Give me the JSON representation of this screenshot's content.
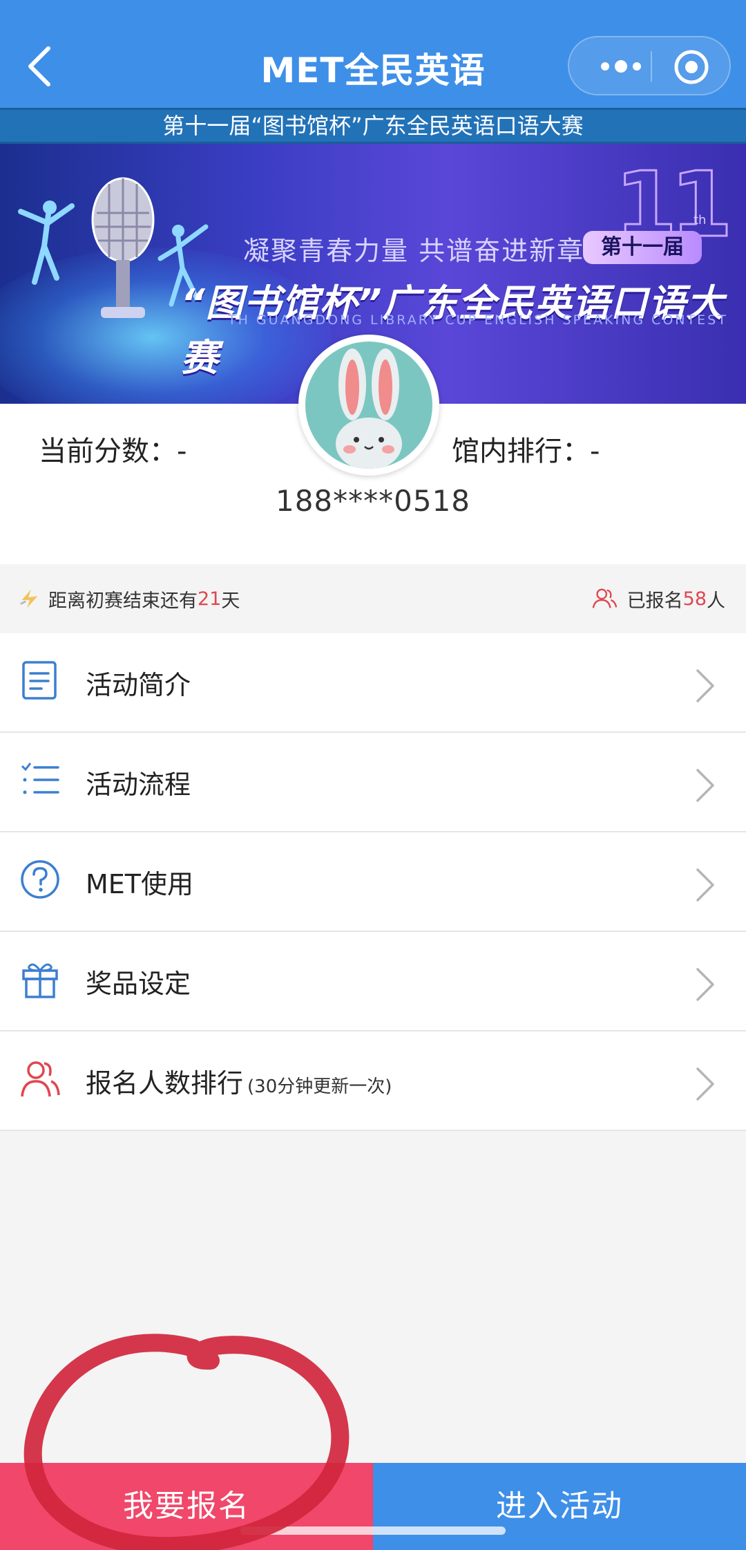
{
  "nav": {
    "title": "MET全民英语",
    "back_icon": "chevron-left-icon",
    "more_icon": "more-dots-icon",
    "close_icon": "target-close-icon"
  },
  "subtitle": "第十一届“图书馆杯”广东全民英语口语大赛",
  "banner": {
    "big_number": "11",
    "ordinal_suffix": "th",
    "slogan": "凝聚青春力量 共谱奋进新章",
    "badge": "第十一届",
    "main": "“图书馆杯”广东全民英语口语大赛",
    "english": "TH GUANGDONG LIBRARY CUP ENGLISH SPEAKING CONTEST"
  },
  "profile": {
    "score_label": "当前分数：-",
    "rank_label": "馆内排行：-",
    "phone": "188****0518",
    "avatar_icon": "bunny-avatar"
  },
  "info": {
    "countdown_prefix": "距离初赛结束还有",
    "countdown_days": "21",
    "countdown_suffix": "天",
    "registered_prefix": "已报名",
    "registered_count": "58",
    "registered_suffix": "人",
    "accent_color": "#e0464f"
  },
  "menu": [
    {
      "label": "活动简介",
      "note": "",
      "icon": "document-icon"
    },
    {
      "label": "活动流程",
      "note": "",
      "icon": "list-icon"
    },
    {
      "label": "MET使用",
      "note": "",
      "icon": "question-icon"
    },
    {
      "label": "奖品设定",
      "note": "",
      "icon": "gift-icon"
    },
    {
      "label": "报名人数排行",
      "note": "(30分钟更新一次)",
      "icon": "users-icon"
    }
  ],
  "buttons": {
    "register": "我要报名",
    "enter": "进入活动"
  },
  "colors": {
    "nav_blue": "#3e8fe8",
    "register_pink": "#f0476a",
    "annotation_red": "#d0263c"
  }
}
